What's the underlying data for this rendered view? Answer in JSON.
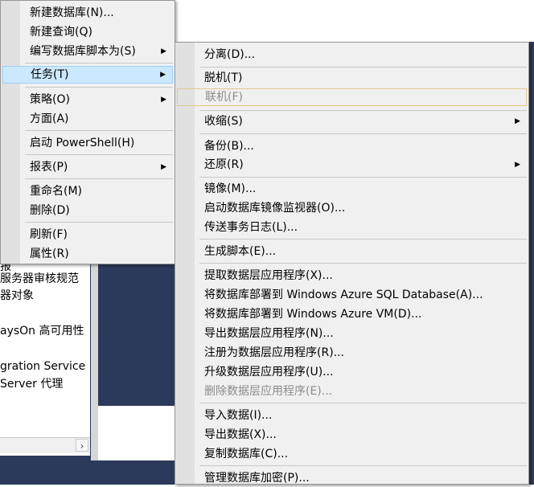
{
  "background": {
    "tree_items": [
      "报",
      "服务器审核规范",
      "器对象",
      "aysOn 高可用性",
      "gration Service",
      " Server 代理"
    ],
    "scroll_arrow": "›"
  },
  "main_menu": {
    "items": [
      {
        "label": "新建数据库(N)...",
        "submenu": false
      },
      {
        "label": "新建查询(Q)",
        "submenu": false
      },
      {
        "label": "编写数据库脚本为(S)",
        "submenu": true
      },
      {
        "label": "任务(T)",
        "submenu": true,
        "state": "highlighted"
      },
      {
        "label": "策略(O)",
        "submenu": true
      },
      {
        "label": "方面(A)",
        "submenu": false
      },
      {
        "label": "启动 PowerShell(H)",
        "submenu": false
      },
      {
        "label": "报表(P)",
        "submenu": true
      },
      {
        "label": "重命名(M)",
        "submenu": false
      },
      {
        "label": "删除(D)",
        "submenu": false
      },
      {
        "label": "刷新(F)",
        "submenu": false
      },
      {
        "label": "属性(R)",
        "submenu": false
      }
    ]
  },
  "tasks_submenu": {
    "items": [
      {
        "label": "分离(D)...",
        "submenu": false
      },
      {
        "label": "脱机(T)",
        "submenu": false
      },
      {
        "label": "联机(F)",
        "submenu": false,
        "disabled": true
      },
      {
        "label": "收缩(S)",
        "submenu": true
      },
      {
        "label": "备份(B)...",
        "submenu": false
      },
      {
        "label": "还原(R)",
        "submenu": true
      },
      {
        "label": "镜像(M)...",
        "submenu": false
      },
      {
        "label": "启动数据库镜像监视器(O)...",
        "submenu": false
      },
      {
        "label": "传送事务日志(L)...",
        "submenu": false
      },
      {
        "label": "生成脚本(E)...",
        "submenu": false
      },
      {
        "label": "提取数据层应用程序(X)...",
        "submenu": false
      },
      {
        "label": "将数据库部署到 Windows Azure SQL Database(A)...",
        "submenu": false
      },
      {
        "label": "将数据库部署到 Windows Azure VM(D)...",
        "submenu": false
      },
      {
        "label": "导出数据层应用程序(N)...",
        "submenu": false
      },
      {
        "label": "注册为数据层应用程序(R)...",
        "submenu": false
      },
      {
        "label": "升级数据层应用程序(U)...",
        "submenu": false
      },
      {
        "label": "删除数据层应用程序(E)...",
        "submenu": false,
        "disabled": true
      },
      {
        "label": "导入数据(I)...",
        "submenu": false
      },
      {
        "label": "导出数据(X)...",
        "submenu": false
      },
      {
        "label": "复制数据库(C)...",
        "submenu": false
      },
      {
        "label": "管理数据库加密(P)...",
        "submenu": false
      }
    ]
  },
  "icons": {
    "submenu_arrow": "▶"
  },
  "colors": {
    "menu_bg": "#f0f0f0",
    "highlight": "#cce8ff",
    "highlight_border": "#99d1ff",
    "disabled_text": "#8c8c8c",
    "app_background": "#2b3a5a"
  }
}
